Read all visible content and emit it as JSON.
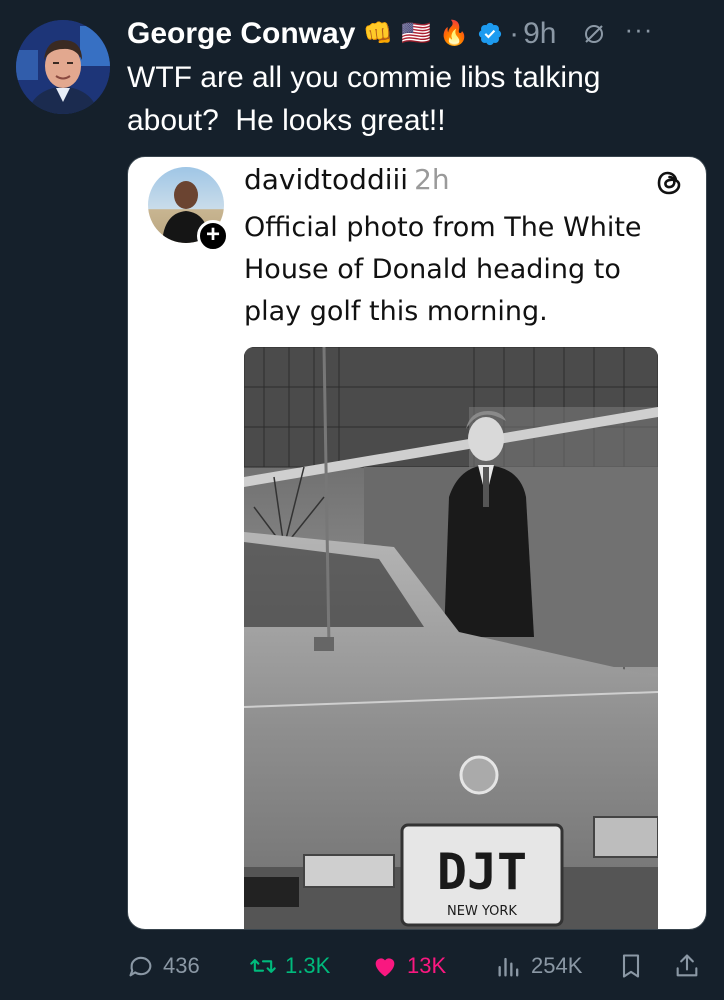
{
  "author": {
    "display_name": "George Conway",
    "emojis": [
      "👊",
      "🇺🇸",
      "🔥"
    ],
    "verified_icon": "verified-badge-icon",
    "separator": "·",
    "time": "9h",
    "more_label": "···"
  },
  "tweet": {
    "text": "WTF are all you commie libs talking\nabout?  He looks great!!"
  },
  "quoted": {
    "username": "davidtoddiii",
    "time": "2h",
    "follow_symbol": "+",
    "text": "Official photo from The White House of Donald heading to play golf this morning.",
    "photo": {
      "plate_text": "DJT",
      "plate_state": "NEW YORK"
    },
    "platform_icon": "threads-icon"
  },
  "actions": {
    "replies": "436",
    "reposts": "1.3K",
    "likes": "13K",
    "views": "254K"
  },
  "colors": {
    "background": "#15202b",
    "muted": "#8b98a5",
    "verified": "#1d9bf0",
    "like": "#f91880",
    "repost": "#00ba7c"
  }
}
